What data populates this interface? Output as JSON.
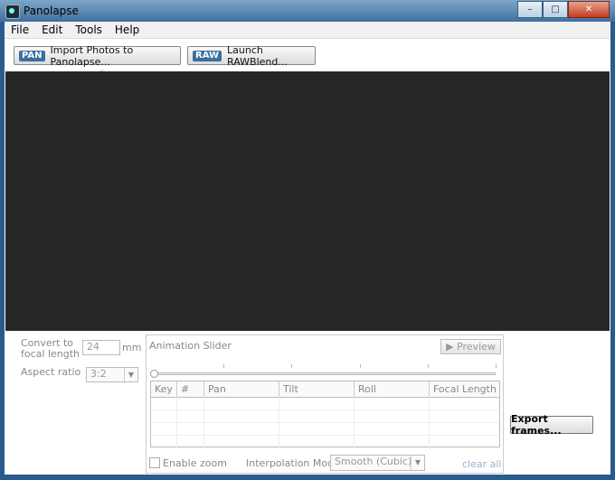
{
  "window": {
    "title": "Panolapse",
    "controls": [
      "–",
      "□",
      "✕"
    ]
  },
  "menu": [
    "File",
    "Edit",
    "Tools",
    "Help"
  ],
  "toolbar": {
    "import": {
      "badge": "PAN",
      "label": "Import Photos to Panolapse..."
    },
    "raw": {
      "badge": "RAW",
      "label": "Launch RAWBlend..."
    }
  },
  "settings": {
    "focal_label_1": "Convert to",
    "focal_label_2": "focal length",
    "focal_value": "24",
    "focal_unit": "mm",
    "aspect_label": "Aspect ratio",
    "aspect_value": "3:2"
  },
  "animation": {
    "title": "Animation Slider",
    "preview_label": "▶ Preview",
    "slider_position": 0,
    "columns": [
      "Key",
      "#",
      "Pan",
      "Tilt",
      "Roll",
      "Focal Length"
    ],
    "rows": [],
    "enable_zoom_label": "Enable zoom",
    "interp_label": "Interpolation Mode:",
    "interp_value": "Smooth (Cubic)",
    "clear_label": "clear all"
  },
  "export_label": "Export frames..."
}
